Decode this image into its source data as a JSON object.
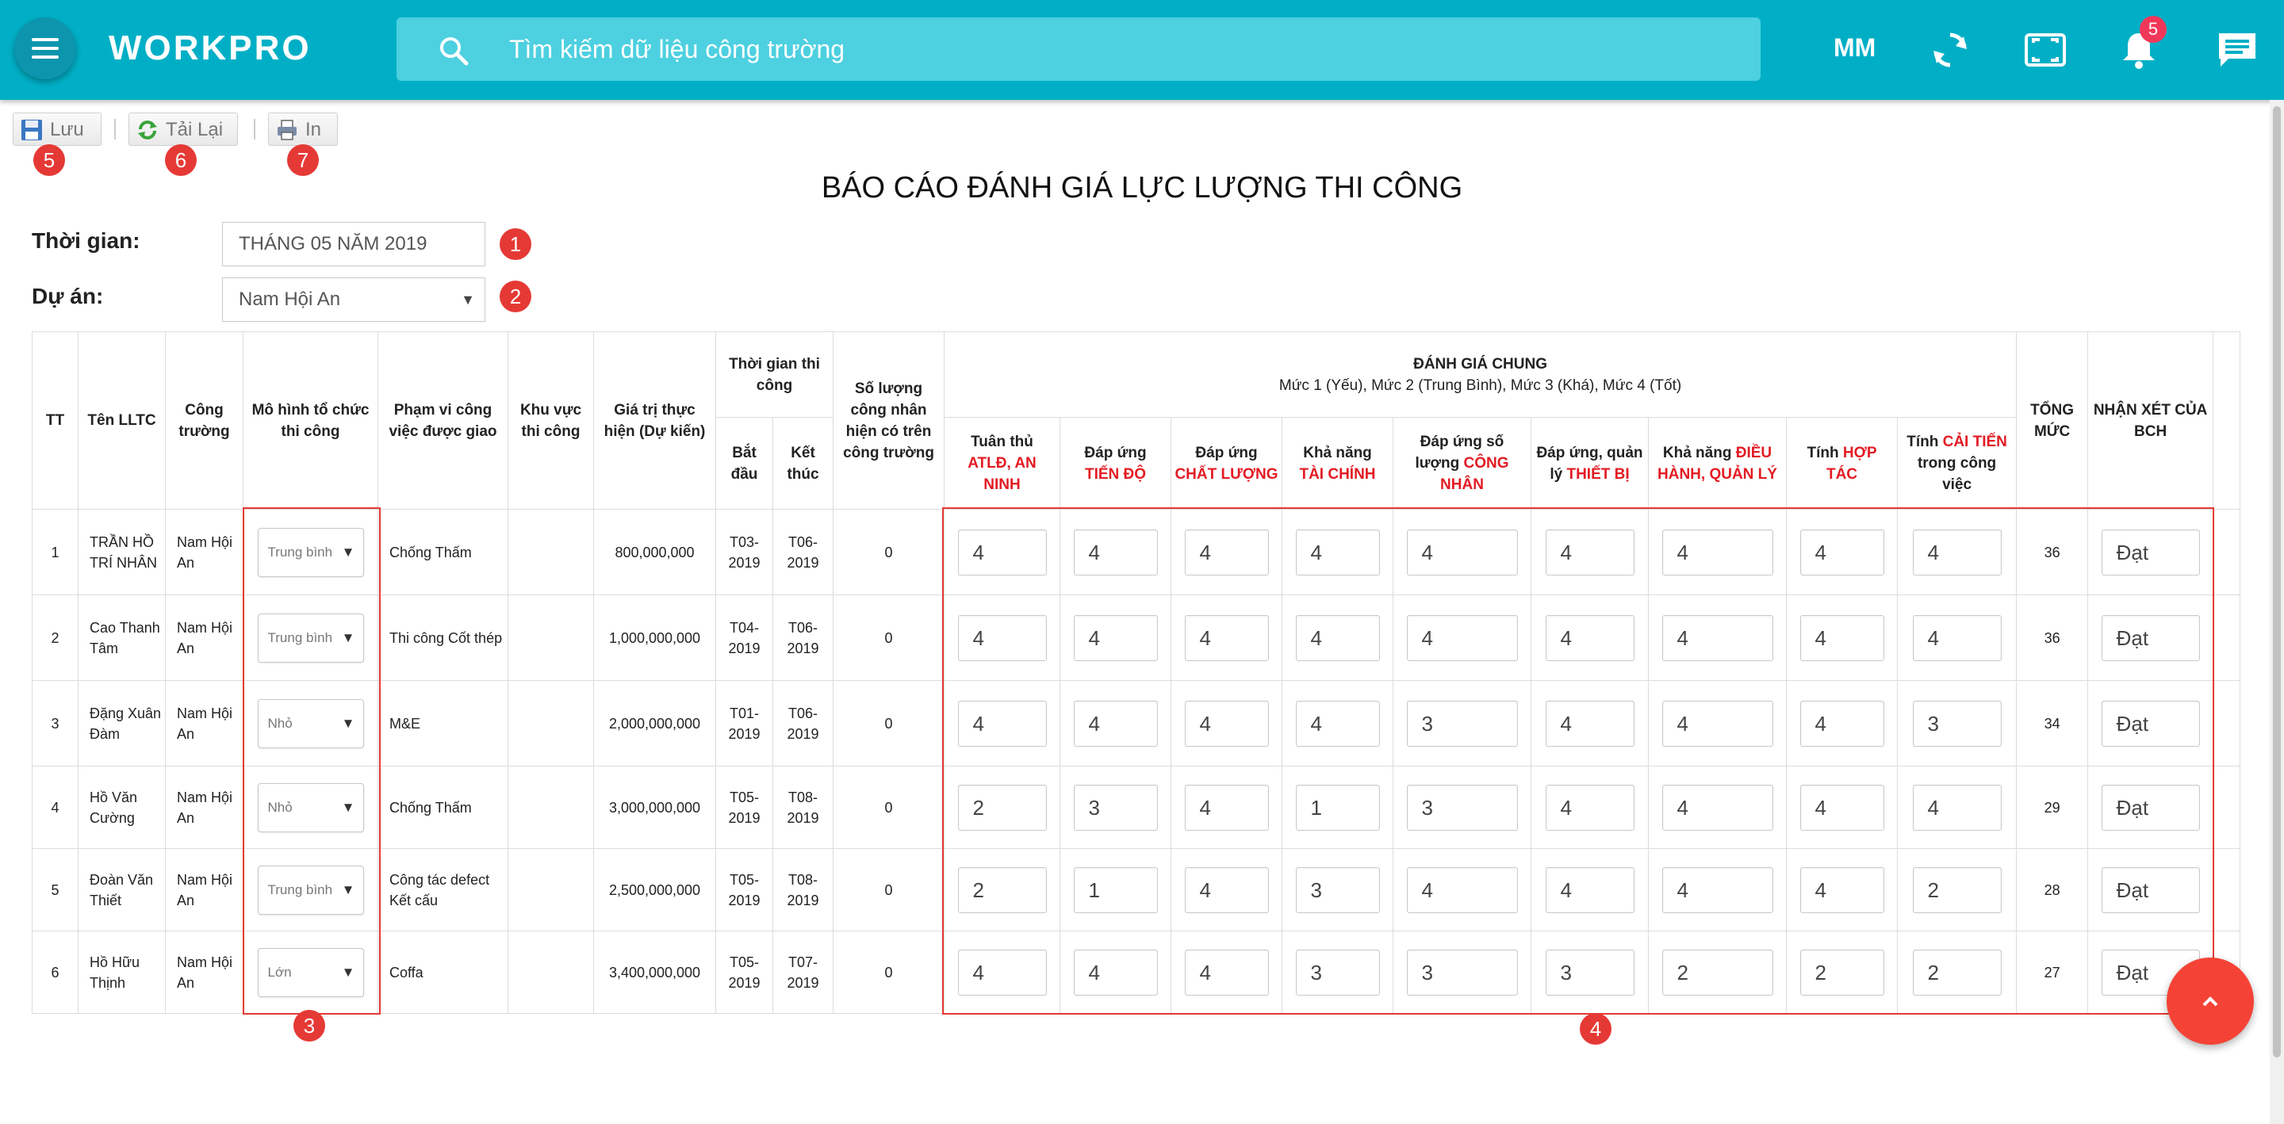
{
  "header": {
    "logo": "WORKPRO",
    "search_placeholder": "Tìm kiếm dữ liệu công trường",
    "user_initials": "MM",
    "notification_count": "5",
    "colors": {
      "bar": "#00afc6",
      "badge": "#f2385a"
    }
  },
  "toolbar": {
    "save_label": "Lưu",
    "reload_label": "Tải Lại",
    "print_label": "In"
  },
  "markers": {
    "m1": "1",
    "m2": "2",
    "m3": "3",
    "m4": "4",
    "m5": "5",
    "m6": "6",
    "m7": "7"
  },
  "report": {
    "title": "BÁO CÁO ĐÁNH GIÁ LỰC LƯỢNG THI CÔNG",
    "time_label": "Thời gian:",
    "time_value": "THÁNG 05 NĂM 2019",
    "project_label": "Dự án:",
    "project_value": "Nam Hội An"
  },
  "table": {
    "headers": {
      "tt": "TT",
      "name": "Tên LLTC",
      "site": "Công trường",
      "model": "Mô hình tổ chức thi công",
      "scope": "Phạm vi công việc được giao",
      "area": "Khu vực thi công",
      "value": "Giá trị thực hiện (Dự kiến)",
      "duration": "Thời gian thi công",
      "start": "Bắt đầu",
      "end": "Kết thúc",
      "workers": "Số lượng công nhân hiện có trên công trường",
      "eval_title": "ĐÁNH GIÁ CHUNG",
      "eval_sub": "Mức 1 (Yếu), Mức 2 (Trung Bình), Mức 3 (Khá), Mức 4 (Tốt)",
      "c1a": "Tuân thủ",
      "c1b": "ATLĐ, AN NINH",
      "c2a": "Đáp ứng",
      "c2b": "TIẾN ĐỘ",
      "c3a": "Đáp ứng",
      "c3b": "CHẤT LƯỢNG",
      "c4a": "Khả năng",
      "c4b": "TÀI CHÍNH",
      "c5a": "Đáp ứng số lượng",
      "c5b": "CÔNG NHÂN",
      "c6a": "Đáp ứng, quản lý",
      "c6b": "THIẾT BỊ",
      "c7a": "Khả năng",
      "c7b": "ĐIỀU HÀNH, QUẢN LÝ",
      "c8a": "Tính",
      "c8b": "HỢP TÁC",
      "c9a": "Tính",
      "c9b": "CẢI TIẾN",
      "c9c": "trong công việc",
      "total": "TỔNG MỨC",
      "comment": "NHẬN XÉT CỦA BCH"
    },
    "rows": [
      {
        "tt": "1",
        "name": "TRẦN HỒ TRÍ NHÂN",
        "site": "Nam Hội An",
        "model": "Trung bình",
        "scope": "Chống Thấm",
        "area": "",
        "value": "800,000,000",
        "start": "T03-2019",
        "end": "T06-2019",
        "workers": "0",
        "scores": [
          "4",
          "4",
          "4",
          "4",
          "4",
          "4",
          "4",
          "4",
          "4"
        ],
        "total": "36",
        "comment": "Đạt"
      },
      {
        "tt": "2",
        "name": "Cao Thanh Tâm",
        "site": "Nam Hội An",
        "model": "Trung bình",
        "scope": "Thi công Cốt thép",
        "area": "",
        "value": "1,000,000,000",
        "start": "T04-2019",
        "end": "T06-2019",
        "workers": "0",
        "scores": [
          "4",
          "4",
          "4",
          "4",
          "4",
          "4",
          "4",
          "4",
          "4"
        ],
        "total": "36",
        "comment": "Đạt"
      },
      {
        "tt": "3",
        "name": "Đặng Xuân Đàm",
        "site": "Nam Hội An",
        "model": "Nhỏ",
        "scope": "M&E",
        "area": "",
        "value": "2,000,000,000",
        "start": "T01-2019",
        "end": "T06-2019",
        "workers": "0",
        "scores": [
          "4",
          "4",
          "4",
          "4",
          "3",
          "4",
          "4",
          "4",
          "3"
        ],
        "total": "34",
        "comment": "Đạt"
      },
      {
        "tt": "4",
        "name": "Hồ Văn Cường",
        "site": "Nam Hội An",
        "model": "Nhỏ",
        "scope": "Chống Thấm",
        "area": "",
        "value": "3,000,000,000",
        "start": "T05-2019",
        "end": "T08-2019",
        "workers": "0",
        "scores": [
          "2",
          "3",
          "4",
          "1",
          "3",
          "4",
          "4",
          "4",
          "4"
        ],
        "total": "29",
        "comment": "Đạt"
      },
      {
        "tt": "5",
        "name": "Đoàn Văn Thiết",
        "site": "Nam Hội An",
        "model": "Trung bình",
        "scope": "Công tác defect Kết cấu",
        "area": "",
        "value": "2,500,000,000",
        "start": "T05-2019",
        "end": "T08-2019",
        "workers": "0",
        "scores": [
          "2",
          "1",
          "4",
          "3",
          "4",
          "4",
          "4",
          "4",
          "2"
        ],
        "total": "28",
        "comment": "Đạt"
      },
      {
        "tt": "6",
        "name": "Hồ Hữu Thịnh",
        "site": "Nam Hội An",
        "model": "Lớn",
        "scope": "Coffa",
        "area": "",
        "value": "3,400,000,000",
        "start": "T05-2019",
        "end": "T07-2019",
        "workers": "0",
        "scores": [
          "4",
          "4",
          "4",
          "3",
          "3",
          "3",
          "2",
          "2",
          "2"
        ],
        "total": "27",
        "comment": "Đạt"
      }
    ]
  }
}
